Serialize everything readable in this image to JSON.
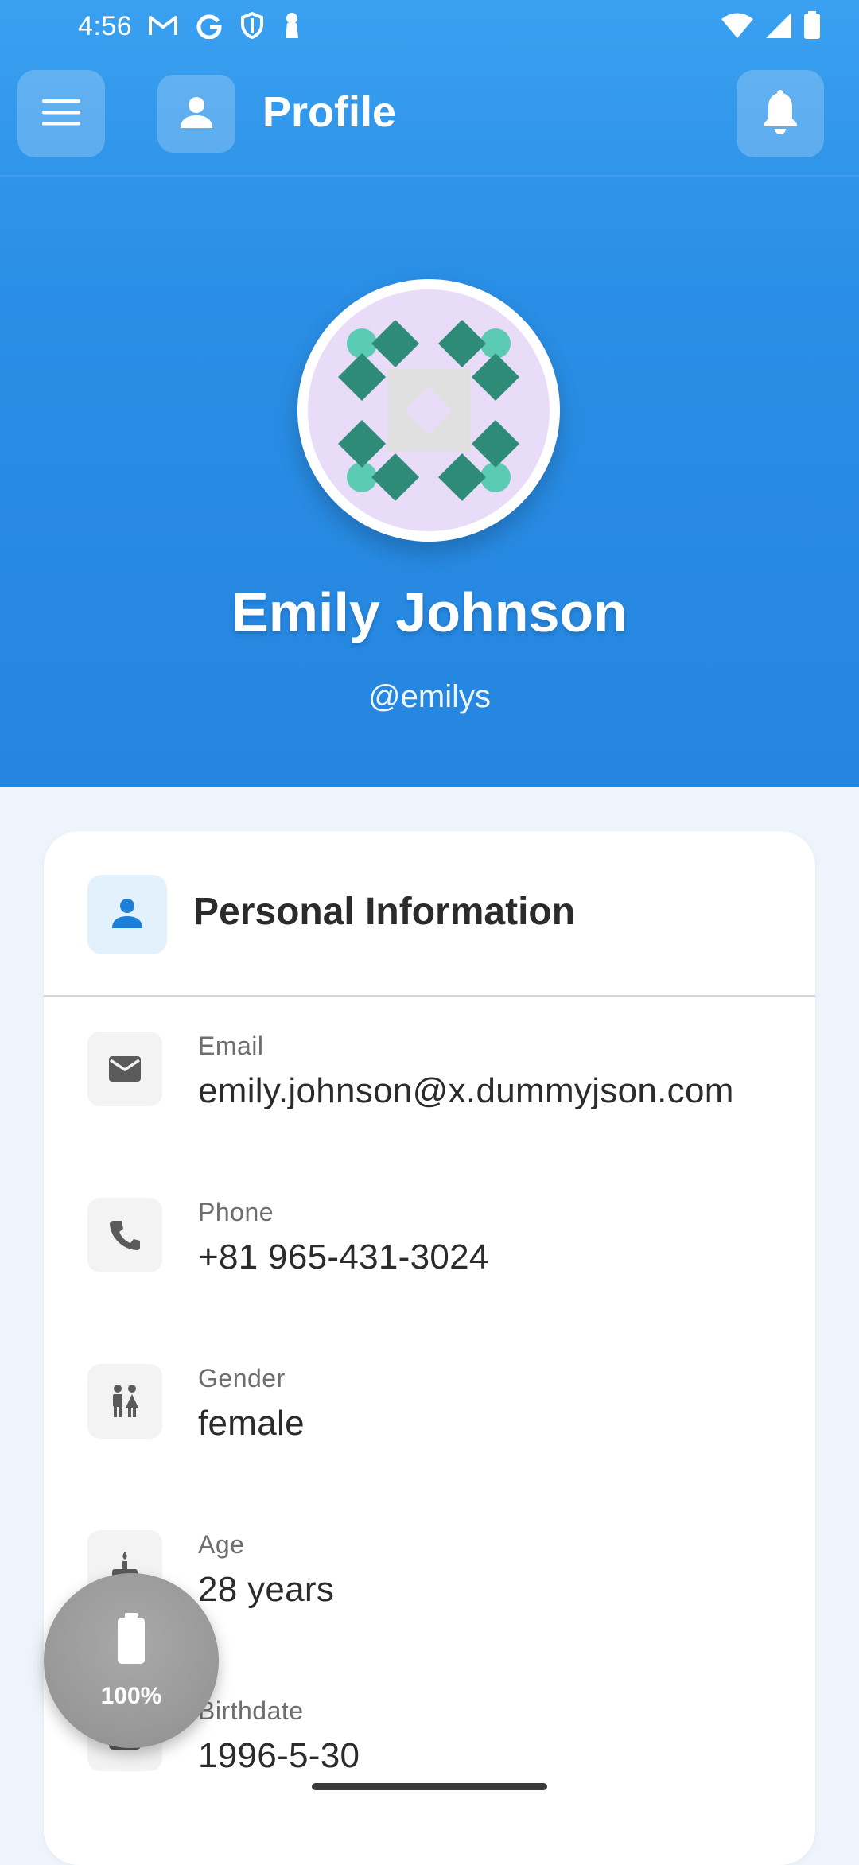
{
  "status_bar": {
    "time": "4:56",
    "left_icons": [
      "gmail-icon",
      "google-icon",
      "shield-icon",
      "keyhole-icon"
    ],
    "right_icons": [
      "wifi-icon",
      "cellular-signal-icon",
      "battery-icon"
    ]
  },
  "app_bar": {
    "title": "Profile",
    "menu_icon": "hamburger-menu-icon",
    "title_icon": "person-icon",
    "notification_icon": "bell-icon"
  },
  "profile": {
    "name": "Emily Johnson",
    "username": "@emilys"
  },
  "personal_info": {
    "title": "Personal Information",
    "items": [
      {
        "label": "Email",
        "value": "emily.johnson@x.dummyjson.com",
        "icon": "mail-icon"
      },
      {
        "label": "Phone",
        "value": "+81 965-431-3024",
        "icon": "phone-icon"
      },
      {
        "label": "Gender",
        "value": "female",
        "icon": "gender-icon"
      },
      {
        "label": "Age",
        "value": "28 years",
        "icon": "age-icon"
      },
      {
        "label": "Birthdate",
        "value": "1996-5-30",
        "icon": "calendar-icon"
      }
    ]
  },
  "battery_overlay": {
    "level": "100%"
  },
  "colors": {
    "primary_blue": "#2a8fe6",
    "avatar_bg": "#e8dcf8",
    "avatar_teal_dark": "#2e8b77",
    "avatar_teal_light": "#5ccbb3",
    "avatar_center_gray": "#e0e0e0"
  }
}
